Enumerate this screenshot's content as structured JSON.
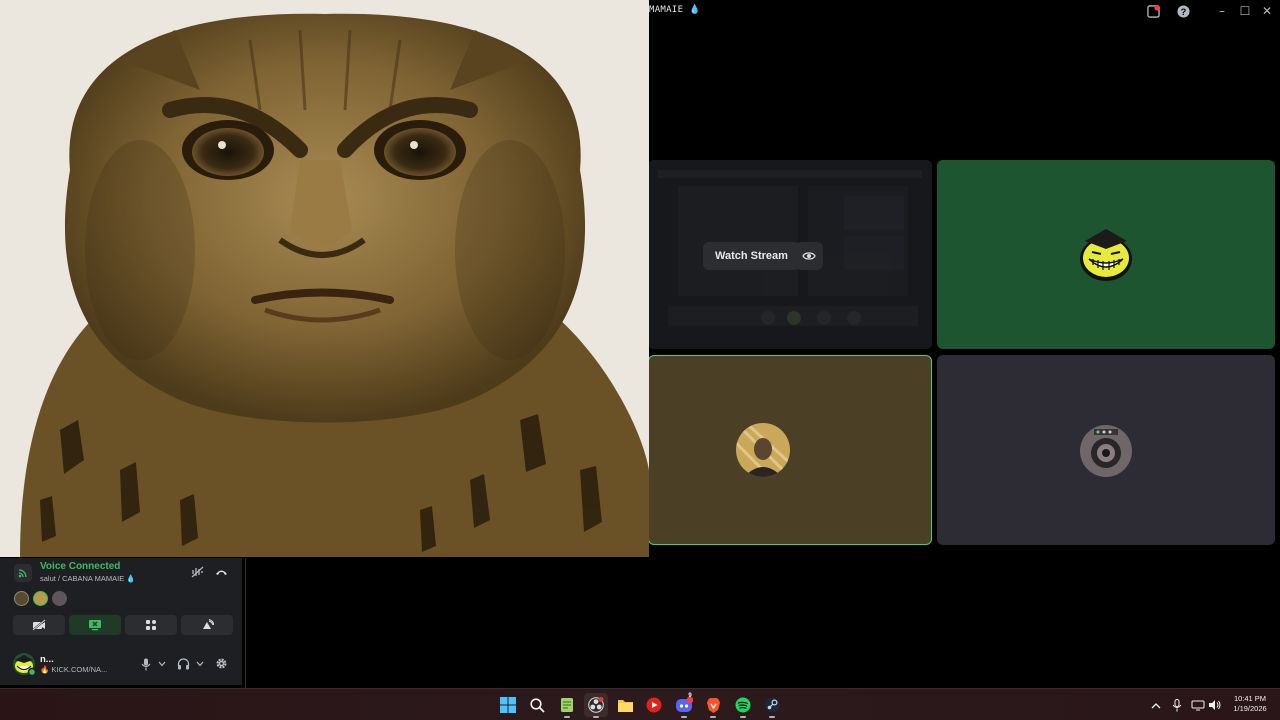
{
  "window": {
    "title": "MAMAIE 💧"
  },
  "stream_tile": {
    "watch_label": "Watch Stream"
  },
  "voice_panel": {
    "status": "Voice Connected",
    "location": "salut / CABANA MAMAIE 💧"
  },
  "user_bar": {
    "name": "n...",
    "status_text": "🔥 KICK.COM/NA..."
  },
  "taskbar": {
    "time": "10:41 PM",
    "date": "1/19/2026",
    "discord_badge": "9"
  },
  "colors": {
    "voice_green": "#3fba63",
    "speaking_border": "#45d17a",
    "tile_green": "#1c5530",
    "tile_brown": "#4b3f26",
    "tile_dark": "#2d2b33"
  }
}
